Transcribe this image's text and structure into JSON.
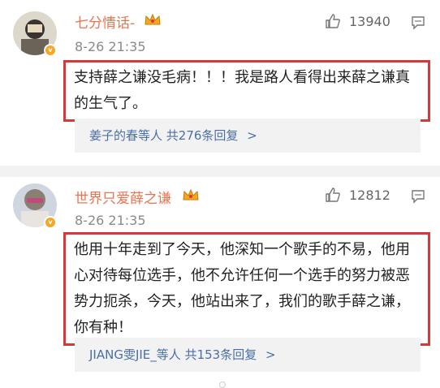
{
  "comments": [
    {
      "username": "七分情话-",
      "timestamp": "8-26 21:35",
      "likes": "13940",
      "text": "支持薛之谦没毛病！！！我是路人看得出来薛之谦真的生气了。",
      "replies_who": "姜子的春等人",
      "replies_total": "共276条回复",
      "replies_chevron": ">"
    },
    {
      "username": "世界只爱薛之谦",
      "timestamp": "8-26 21:35",
      "likes": "12812",
      "text": "他用十年走到了今天，他深知一个歌手的不易，他用心对待每位选手，他不允许任何一个选手的努力被恶势力扼杀，今天，他站出来了，我们的歌手薛之谦，你有种！",
      "replies_who": "JIANG雯JIE_等人",
      "replies_total": "共153条回复",
      "replies_chevron": ">"
    }
  ],
  "colors": {
    "username": "#eb7350",
    "highlight_border": "#d43a3a",
    "link_blue": "#4a6fa8",
    "crown_gold": "#f5a623"
  },
  "icons": [
    "avatar",
    "verified-badge-icon",
    "crown-icon",
    "thumbs-up-icon",
    "reply-icon"
  ]
}
